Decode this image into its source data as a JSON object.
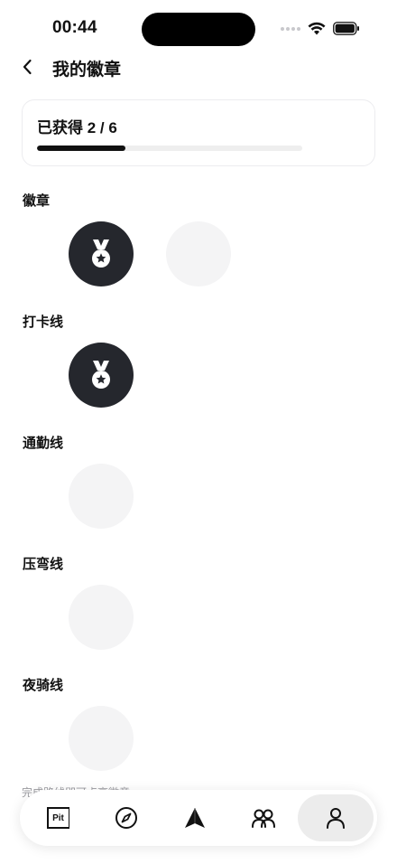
{
  "status_bar": {
    "time": "00:44"
  },
  "header": {
    "title": "我的徽章"
  },
  "progress": {
    "label": "已获得 2 / 6",
    "earned": 2,
    "total": 6,
    "fraction": 0.333
  },
  "sections": [
    {
      "title": "徽章",
      "badges": [
        "earned",
        "locked"
      ]
    },
    {
      "title": "打卡线",
      "badges": [
        "earned"
      ]
    },
    {
      "title": "通勤线",
      "badges": [
        "locked"
      ]
    },
    {
      "title": "压弯线",
      "badges": [
        "locked"
      ]
    },
    {
      "title": "夜骑线",
      "badges": [
        "locked"
      ]
    }
  ],
  "footer_hint": "完成路线即可点亮徽章",
  "tabbar": {
    "pit_label": "Pit",
    "items": [
      "pit-icon",
      "compass-icon",
      "navigate-icon",
      "community-icon",
      "profile-icon"
    ],
    "active_index": 4
  }
}
